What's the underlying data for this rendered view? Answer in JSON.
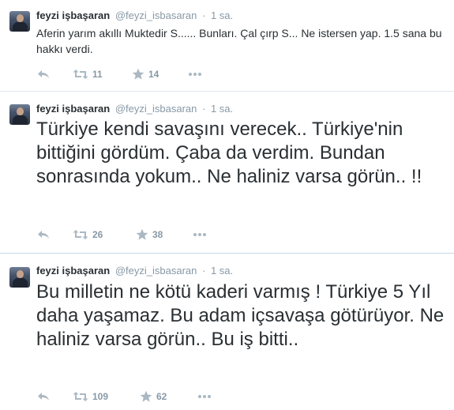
{
  "tweets": [
    {
      "name": "feyzi işbaşaran",
      "handle": "@feyzi_isbasaran",
      "time": "1 sa.",
      "text": "Aferin yarım akıllı Muktedir S...... Bunları. Çal çırp S... Ne istersen yap. 1.5 sana bu hakkı verdi.",
      "retweets": "11",
      "favorites": "14"
    },
    {
      "name": "feyzi işbaşaran",
      "handle": "@feyzi_isbasaran",
      "time": "1 sa.",
      "text": "Türkiye kendi savaşını verecek.. Türkiye'nin bittiğini gördüm. Çaba da verdim. Bundan sonrasında yokum.. Ne haliniz varsa görün.. !!",
      "retweets": "26",
      "favorites": "38"
    },
    {
      "name": "feyzi işbaşaran",
      "handle": "@feyzi_isbasaran",
      "time": "1 sa.",
      "text": "Bu milletin ne kötü kaderi varmış ! Türkiye 5 Yıl daha yaşamaz. Bu adam içsavaşa götürüyor. Ne haliniz varsa görün.. Bu iş bitti..",
      "retweets": "109",
      "favorites": "62"
    }
  ],
  "icons": {
    "reply": "reply-icon",
    "retweet": "retweet-icon",
    "favorite": "star-icon",
    "more": "more-icon"
  },
  "colors": {
    "text": "#292f33",
    "muted": "#8899a6",
    "divider": "#e1e8ed"
  }
}
